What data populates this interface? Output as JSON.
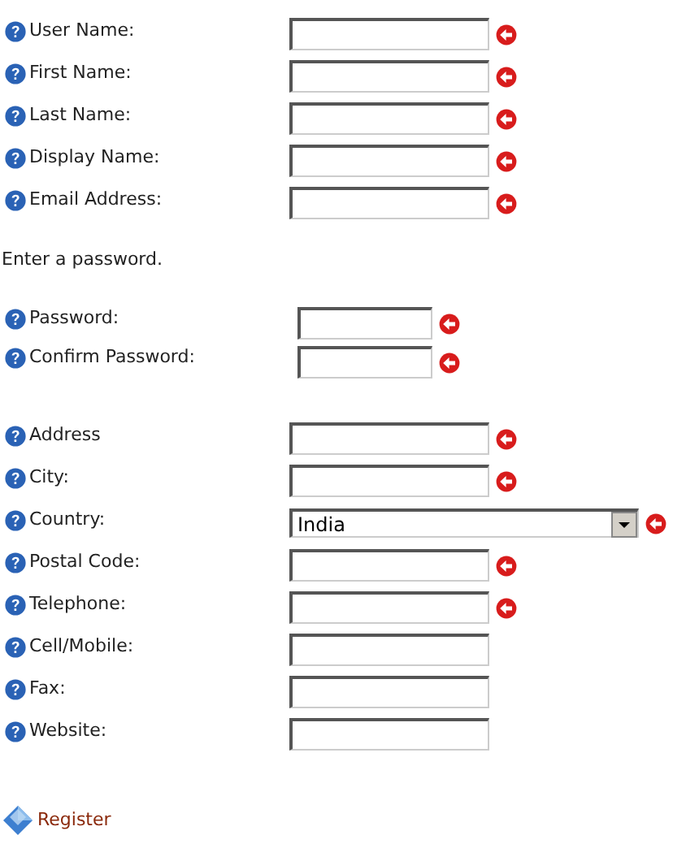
{
  "sections": [
    {
      "fields": [
        {
          "label": "User Name:",
          "required": true,
          "kind": "text"
        },
        {
          "label": "First Name:",
          "required": true,
          "kind": "text"
        },
        {
          "label": "Last Name:",
          "required": true,
          "kind": "text"
        },
        {
          "label": "Display Name:",
          "required": true,
          "kind": "text"
        },
        {
          "label": "Email Address:",
          "required": true,
          "kind": "text"
        }
      ]
    },
    {
      "intro": "Enter a password.",
      "fields": [
        {
          "label": "Password:",
          "required": true,
          "kind": "password"
        },
        {
          "label": "Confirm Password:",
          "required": true,
          "kind": "password"
        }
      ]
    },
    {
      "fields": [
        {
          "label": "Address",
          "required": true,
          "kind": "text"
        },
        {
          "label": "City:",
          "required": true,
          "kind": "text"
        },
        {
          "label": "Country:",
          "required": true,
          "kind": "select",
          "value": "India"
        },
        {
          "label": "Postal Code:",
          "required": true,
          "kind": "text"
        },
        {
          "label": "Telephone:",
          "required": true,
          "kind": "text"
        },
        {
          "label": "Cell/Mobile:",
          "required": false,
          "kind": "text"
        },
        {
          "label": "Fax:",
          "required": false,
          "kind": "text"
        },
        {
          "label": "Website:",
          "required": false,
          "kind": "text"
        }
      ]
    }
  ],
  "register": {
    "label": "Register"
  }
}
